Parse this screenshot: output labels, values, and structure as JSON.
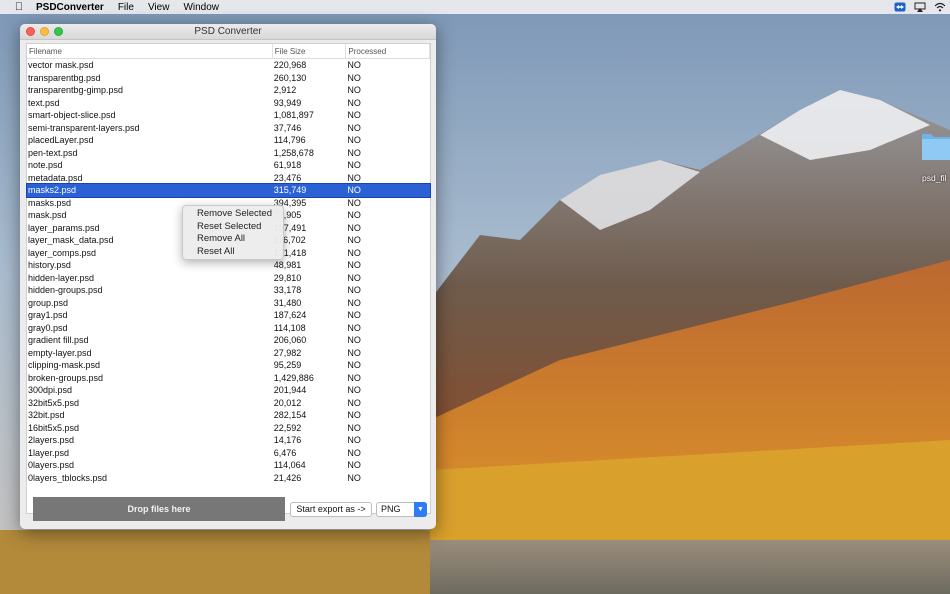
{
  "menubar": {
    "app_name": "PSDConverter",
    "menus": [
      "File",
      "View",
      "Window"
    ]
  },
  "window": {
    "title": "PSD Converter"
  },
  "table": {
    "headers": {
      "filename": "Filename",
      "size": "File Size",
      "processed": "Processed"
    },
    "rows": [
      {
        "name": "vector mask.psd",
        "size": "220,968",
        "processed": "NO"
      },
      {
        "name": "transparentbg.psd",
        "size": "260,130",
        "processed": "NO"
      },
      {
        "name": "transparentbg-gimp.psd",
        "size": "2,912",
        "processed": "NO"
      },
      {
        "name": "text.psd",
        "size": "93,949",
        "processed": "NO"
      },
      {
        "name": "smart-object-slice.psd",
        "size": "1,081,897",
        "processed": "NO"
      },
      {
        "name": "semi-transparent-layers.psd",
        "size": "37,746",
        "processed": "NO"
      },
      {
        "name": "placedLayer.psd",
        "size": "114,796",
        "processed": "NO"
      },
      {
        "name": "pen-text.psd",
        "size": "1,258,678",
        "processed": "NO"
      },
      {
        "name": "note.psd",
        "size": "61,918",
        "processed": "NO"
      },
      {
        "name": "metadata.psd",
        "size": "23,476",
        "processed": "NO"
      },
      {
        "name": "masks2.psd",
        "size": "315,749",
        "processed": "NO"
      },
      {
        "name": "masks.psd",
        "size": "394,395",
        "processed": "NO"
      },
      {
        "name": "mask.psd",
        "size": "72,905",
        "processed": "NO"
      },
      {
        "name": "layer_params.psd",
        "size": "197,491",
        "processed": "NO"
      },
      {
        "name": "layer_mask_data.psd",
        "size": "116,702",
        "processed": "NO"
      },
      {
        "name": "layer_comps.psd",
        "size": "121,418",
        "processed": "NO"
      },
      {
        "name": "history.psd",
        "size": "48,981",
        "processed": "NO"
      },
      {
        "name": "hidden-layer.psd",
        "size": "29,810",
        "processed": "NO"
      },
      {
        "name": "hidden-groups.psd",
        "size": "33,178",
        "processed": "NO"
      },
      {
        "name": "group.psd",
        "size": "31,480",
        "processed": "NO"
      },
      {
        "name": "gray1.psd",
        "size": "187,624",
        "processed": "NO"
      },
      {
        "name": "gray0.psd",
        "size": "114,108",
        "processed": "NO"
      },
      {
        "name": "gradient fill.psd",
        "size": "206,060",
        "processed": "NO"
      },
      {
        "name": "empty-layer.psd",
        "size": "27,982",
        "processed": "NO"
      },
      {
        "name": "clipping-mask.psd",
        "size": "95,259",
        "processed": "NO"
      },
      {
        "name": "broken-groups.psd",
        "size": "1,429,886",
        "processed": "NO"
      },
      {
        "name": "300dpi.psd",
        "size": "201,944",
        "processed": "NO"
      },
      {
        "name": "32bit5x5.psd",
        "size": "20,012",
        "processed": "NO"
      },
      {
        "name": "32bit.psd",
        "size": "282,154",
        "processed": "NO"
      },
      {
        "name": "16bit5x5.psd",
        "size": "22,592",
        "processed": "NO"
      },
      {
        "name": "2layers.psd",
        "size": "14,176",
        "processed": "NO"
      },
      {
        "name": "1layer.psd",
        "size": "6,476",
        "processed": "NO"
      },
      {
        "name": "0layers.psd",
        "size": "114,064",
        "processed": "NO"
      },
      {
        "name": "0layers_tblocks.psd",
        "size": "21,426",
        "processed": "NO"
      }
    ],
    "selected_index": 10
  },
  "context_menu": {
    "items": [
      "Remove Selected",
      "Reset Selected",
      "Remove All",
      "Reset All"
    ]
  },
  "controls": {
    "drop_label": "Drop files here",
    "export_label": "Start export as ->",
    "format_value": "PNG"
  },
  "desktop": {
    "folder_label": "psd_fil"
  },
  "colors": {
    "selection": "#2a62d6",
    "drop_zone": "#777777",
    "select_accent": "#2f7cf6"
  }
}
